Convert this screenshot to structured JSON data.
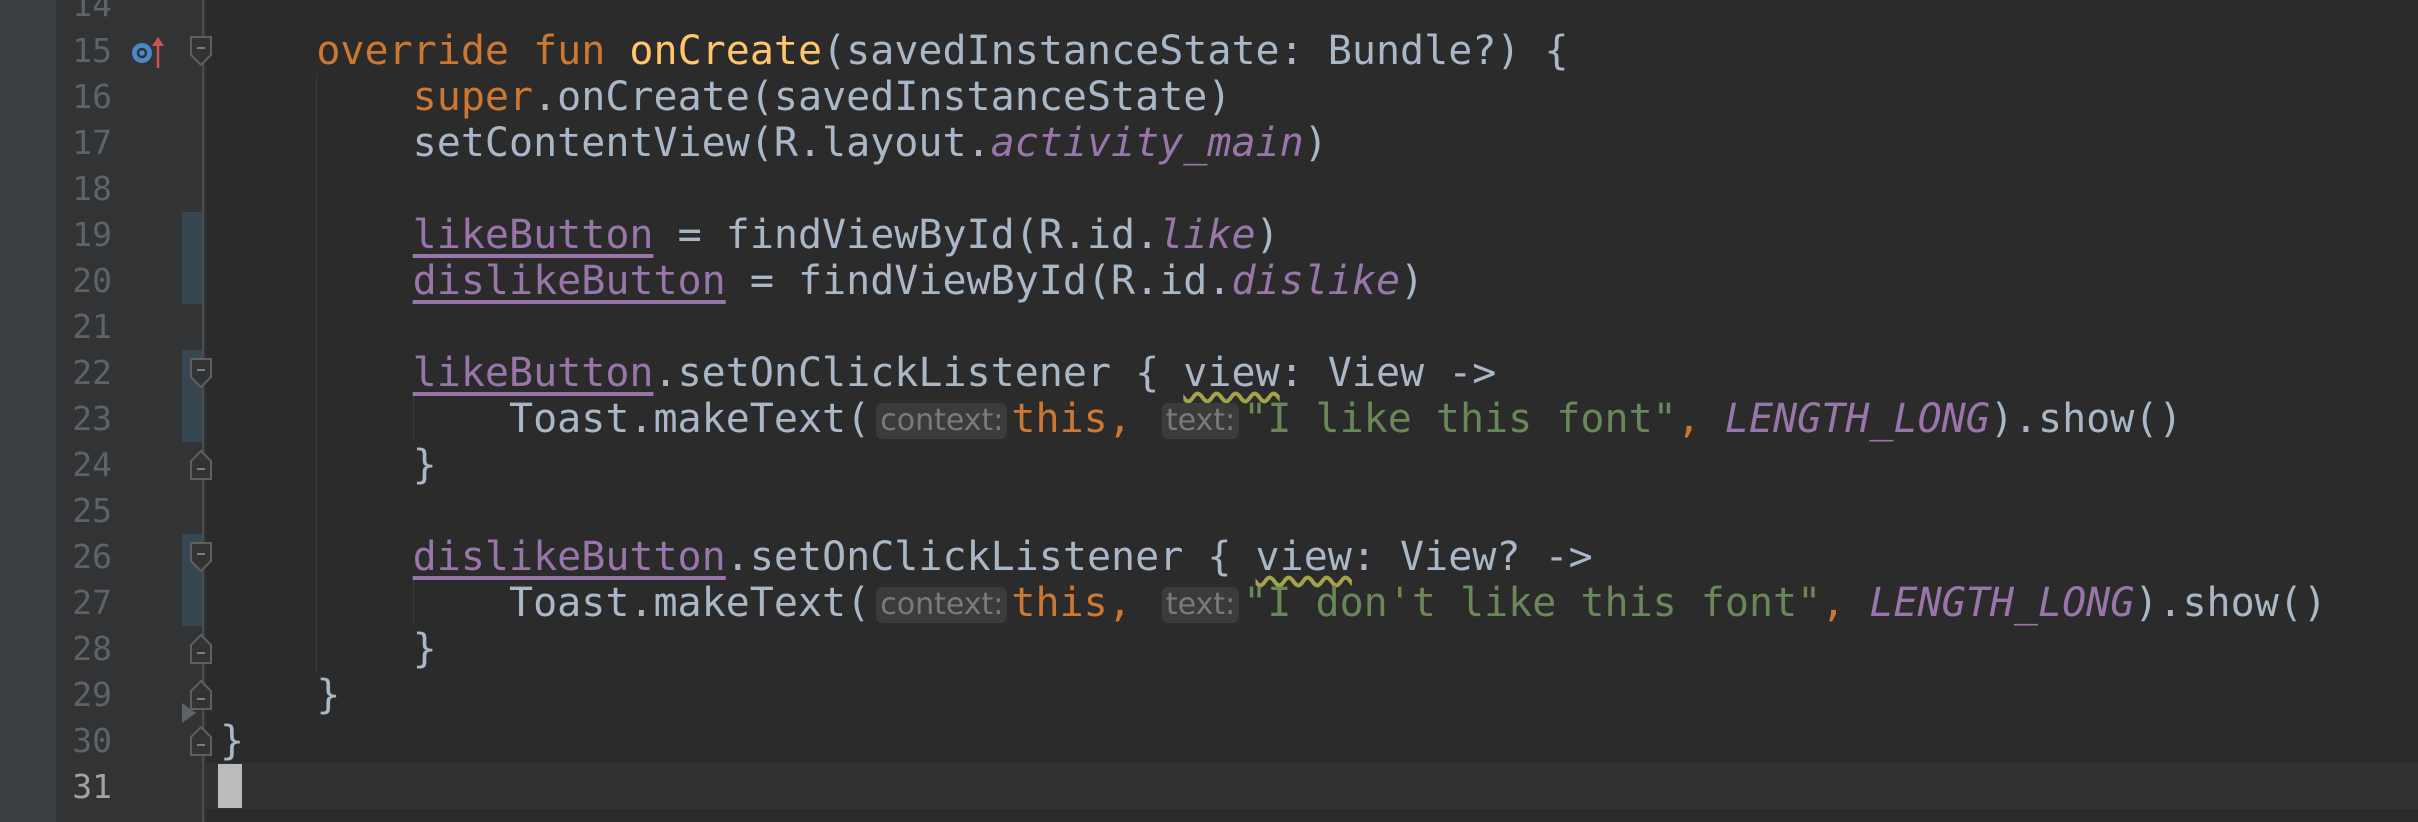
{
  "editor": {
    "current_line": 31,
    "colors": {
      "background": "#2b2b2b",
      "keyword": "#cc7832",
      "function": "#ffc66d",
      "text": "#a9b7c6",
      "property": "#9876aa",
      "string": "#6a8759",
      "line_number": "#606366"
    },
    "lines": [
      {
        "n": "14",
        "tokens": []
      },
      {
        "n": "15",
        "tokens": [
          {
            "t": "    ",
            "k": "plain"
          },
          {
            "t": "override",
            "k": "kw"
          },
          {
            "t": " ",
            "k": "plain"
          },
          {
            "t": "fun",
            "k": "kw"
          },
          {
            "t": " ",
            "k": "plain"
          },
          {
            "t": "onCreate",
            "k": "fn"
          },
          {
            "t": "(savedInstanceState: Bundle?) {",
            "k": "plain"
          }
        ]
      },
      {
        "n": "16",
        "tokens": [
          {
            "t": "        ",
            "k": "plain"
          },
          {
            "t": "super",
            "k": "kw"
          },
          {
            "t": ".onCreate(savedInstanceState)",
            "k": "plain"
          }
        ]
      },
      {
        "n": "17",
        "tokens": [
          {
            "t": "        setContentView(R.layout.",
            "k": "plain"
          },
          {
            "t": "activity_main",
            "k": "static"
          },
          {
            "t": ")",
            "k": "plain"
          }
        ]
      },
      {
        "n": "18",
        "tokens": []
      },
      {
        "n": "19",
        "tokens": [
          {
            "t": "        ",
            "k": "plain"
          },
          {
            "t": "likeButton",
            "k": "prop"
          },
          {
            "t": " = findViewById(R.id.",
            "k": "plain"
          },
          {
            "t": "like",
            "k": "static"
          },
          {
            "t": ")",
            "k": "plain"
          }
        ]
      },
      {
        "n": "20",
        "tokens": [
          {
            "t": "        ",
            "k": "plain"
          },
          {
            "t": "dislikeButton",
            "k": "prop"
          },
          {
            "t": " = findViewById(R.id.",
            "k": "plain"
          },
          {
            "t": "dislike",
            "k": "static"
          },
          {
            "t": ")",
            "k": "plain"
          }
        ]
      },
      {
        "n": "21",
        "tokens": []
      },
      {
        "n": "22",
        "tokens": [
          {
            "t": "        ",
            "k": "plain"
          },
          {
            "t": "likeButton",
            "k": "prop"
          },
          {
            "t": ".setOnClickListener { ",
            "k": "plain"
          },
          {
            "t": "view",
            "k": "warn"
          },
          {
            "t": ": View ->",
            "k": "plain"
          }
        ]
      },
      {
        "n": "23",
        "tokens": [
          {
            "t": "            Toast.makeText(",
            "k": "plain"
          },
          {
            "t": "context:",
            "k": "hint"
          },
          {
            "t": "this,",
            "k": "kw"
          },
          {
            "t": " ",
            "k": "plain"
          },
          {
            "t": "text:",
            "k": "hint"
          },
          {
            "t": "\"I like this font\"",
            "k": "str"
          },
          {
            "t": ",",
            "k": "kw"
          },
          {
            "t": " ",
            "k": "plain"
          },
          {
            "t": "LENGTH_LONG",
            "k": "static"
          },
          {
            "t": ").show()",
            "k": "plain"
          }
        ]
      },
      {
        "n": "24",
        "tokens": [
          {
            "t": "        }",
            "k": "plain"
          }
        ]
      },
      {
        "n": "25",
        "tokens": []
      },
      {
        "n": "26",
        "tokens": [
          {
            "t": "        ",
            "k": "plain"
          },
          {
            "t": "dislikeButton",
            "k": "prop"
          },
          {
            "t": ".setOnClickListener { ",
            "k": "plain"
          },
          {
            "t": "view",
            "k": "warn"
          },
          {
            "t": ": View? ->",
            "k": "plain"
          }
        ]
      },
      {
        "n": "27",
        "tokens": [
          {
            "t": "            Toast.makeText(",
            "k": "plain"
          },
          {
            "t": "context:",
            "k": "hint"
          },
          {
            "t": "this,",
            "k": "kw"
          },
          {
            "t": " ",
            "k": "plain"
          },
          {
            "t": "text:",
            "k": "hint"
          },
          {
            "t": "\"I don't like this font\"",
            "k": "str"
          },
          {
            "t": ",",
            "k": "kw"
          },
          {
            "t": " ",
            "k": "plain"
          },
          {
            "t": "LENGTH_LONG",
            "k": "static"
          },
          {
            "t": ").show()",
            "k": "plain"
          }
        ]
      },
      {
        "n": "28",
        "tokens": [
          {
            "t": "        }",
            "k": "plain"
          }
        ]
      },
      {
        "n": "29",
        "tokens": [
          {
            "t": "    }",
            "k": "plain"
          }
        ]
      },
      {
        "n": "30",
        "tokens": [
          {
            "t": "}",
            "k": "plain"
          }
        ]
      },
      {
        "n": "31",
        "tokens": []
      }
    ],
    "gutter": {
      "override_icon_line": "15",
      "fold_start_lines": [
        "15",
        "22",
        "26"
      ],
      "fold_end_lines": [
        "24",
        "28",
        "29",
        "30"
      ],
      "changed_lines": [
        "19",
        "20",
        "22",
        "23",
        "26",
        "27"
      ]
    }
  }
}
